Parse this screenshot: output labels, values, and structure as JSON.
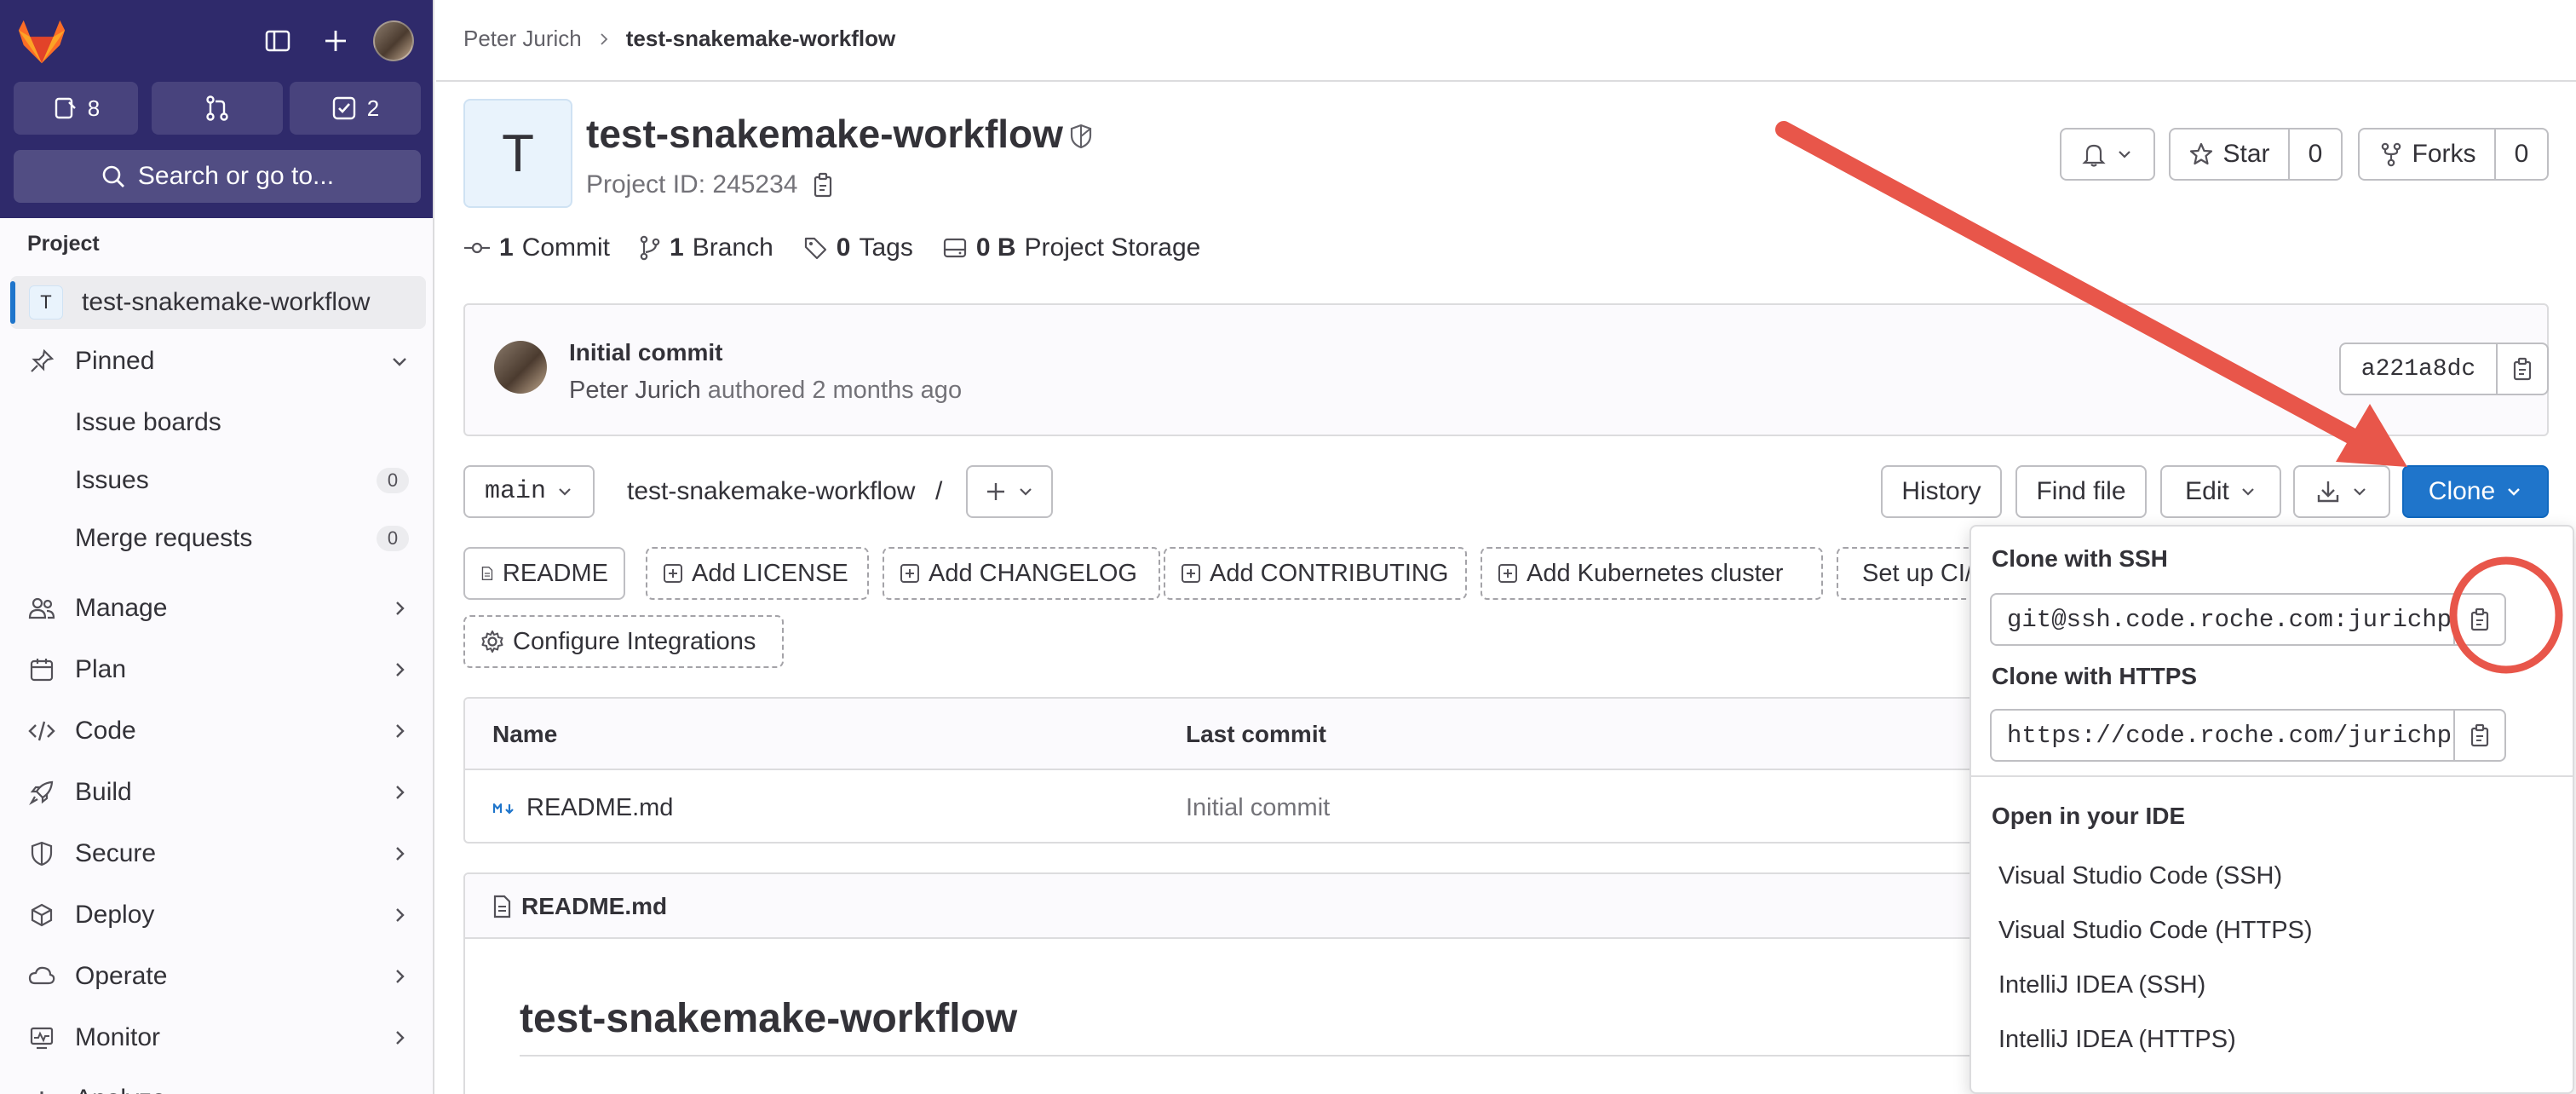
{
  "sidebar": {
    "todo_count": "8",
    "review_count": "2",
    "search_label": "Search or go to...",
    "section_heading": "Project",
    "project_badge": "T",
    "project_name": "test-snakemake-workflow",
    "pinned": "Pinned",
    "pinned_items": [
      {
        "label": "Issue boards"
      },
      {
        "label": "Issues",
        "count": "0"
      },
      {
        "label": "Merge requests",
        "count": "0"
      }
    ],
    "nav": [
      "Manage",
      "Plan",
      "Code",
      "Build",
      "Secure",
      "Deploy",
      "Operate",
      "Monitor",
      "Analyze"
    ]
  },
  "breadcrumb": {
    "parent": "Peter Jurich",
    "current": "test-snakemake-workflow"
  },
  "project": {
    "avatar_letter": "T",
    "title": "test-snakemake-workflow",
    "id_label": "Project ID: 245234",
    "star_label": "Star",
    "star_count": "0",
    "forks_label": "Forks",
    "forks_count": "0"
  },
  "stats": {
    "commits_num": "1",
    "commits_label": "Commit",
    "branches_num": "1",
    "branches_label": "Branch",
    "tags_num": "0",
    "tags_label": "Tags",
    "storage_num": "0 B",
    "storage_label": "Project Storage"
  },
  "commit": {
    "title": "Initial commit",
    "author": "Peter Jurich",
    "meta": "authored 2 months ago",
    "sha": "a221a8dc"
  },
  "repo": {
    "branch": "main",
    "path": "test-snakemake-workflow",
    "separator": "/",
    "history": "History",
    "find_file": "Find file",
    "edit": "Edit",
    "clone": "Clone"
  },
  "quick_actions": [
    "README",
    "Add LICENSE",
    "Add CHANGELOG",
    "Add CONTRIBUTING",
    "Add Kubernetes cluster",
    "Set up CI/CD",
    "Configure Integrations"
  ],
  "files": {
    "headers": [
      "Name",
      "Last commit"
    ],
    "rows": [
      {
        "name": "README.md",
        "last_commit": "Initial commit"
      }
    ]
  },
  "readme": {
    "filename": "README.md",
    "heading": "test-snakemake-workflow"
  },
  "clone_dropdown": {
    "ssh_label": "Clone with SSH",
    "ssh_url": "git@ssh.code.roche.com:jurichp/",
    "https_label": "Clone with HTTPS",
    "https_url": "https://code.roche.com/jurichp/",
    "ide_label": "Open in your IDE",
    "ide_items": [
      "Visual Studio Code (SSH)",
      "Visual Studio Code (HTTPS)",
      "IntelliJ IDEA (SSH)",
      "IntelliJ IDEA (HTTPS)"
    ]
  },
  "colors": {
    "sidebar_top": "#2f2a6b",
    "primary": "#1f75cb",
    "annotation": "#e8564a"
  }
}
